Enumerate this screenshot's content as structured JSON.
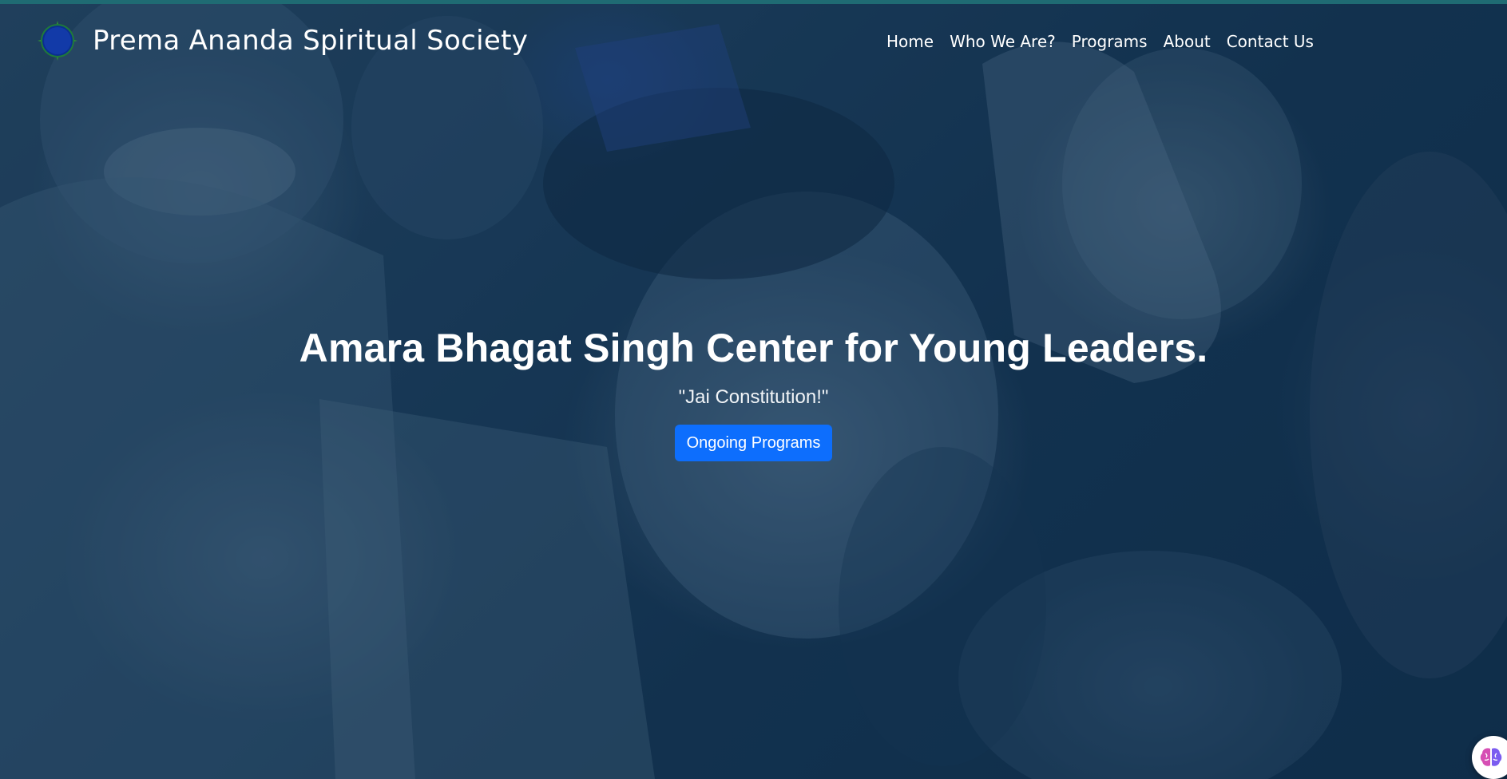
{
  "colors": {
    "top_strip": "#1f6b73",
    "overlay": "#0a2a44",
    "cta_background": "#0d6efd",
    "text": "#ffffff"
  },
  "navbar": {
    "brand_name": "Prema Ananda Spiritual Society",
    "logo_icon": "globe-logo-icon",
    "links": [
      {
        "label": "Home"
      },
      {
        "label": "Who We Are?"
      },
      {
        "label": "Programs"
      },
      {
        "label": "About"
      },
      {
        "label": "Contact Us"
      }
    ]
  },
  "hero": {
    "background_image": "smiling-children-photo",
    "title": "Amara Bhagat Singh Center for Young Leaders.",
    "subtitle": "\"Jai Constitution!\"",
    "cta_label": "Ongoing Programs"
  },
  "floating_widget": {
    "icon": "brain-icon"
  }
}
